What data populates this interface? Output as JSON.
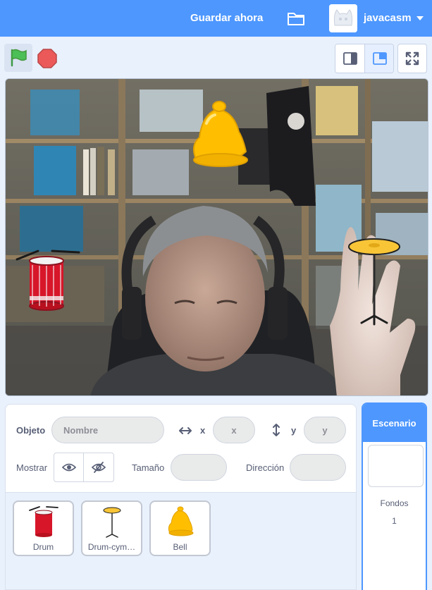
{
  "menu": {
    "save_now": "Guardar ahora",
    "username": "javacasm",
    "folder_icon": "folder-icon",
    "caret_icon": "caret-down-icon"
  },
  "controls": {
    "green_flag_icon": "green-flag-icon",
    "stop_icon": "stop-icon",
    "small_stage_icon": "small-stage-icon",
    "normal_stage_icon": "normal-stage-icon",
    "fullscreen_icon": "fullscreen-icon"
  },
  "stage": {
    "sprites": [
      "Drum",
      "Drum-cymbal",
      "Bell"
    ]
  },
  "sprite_info": {
    "sprite_label": "Objeto",
    "name_placeholder": "Nombre",
    "x_label": "x",
    "x_placeholder": "x",
    "y_label": "y",
    "y_placeholder": "y",
    "show_label": "Mostrar",
    "size_label": "Tamaño",
    "direction_label": "Dirección"
  },
  "sprite_list": [
    {
      "name": "Drum"
    },
    {
      "name": "Drum-cym…"
    },
    {
      "name": "Bell"
    }
  ],
  "stage_panel": {
    "title": "Escenario",
    "backdrops_label": "Fondos",
    "backdrops_count": "1"
  },
  "colors": {
    "menu_blue": "#4d97ff",
    "flag_green": "#4cbf56",
    "stop_red": "#ec5959",
    "drum_red": "#d7162a",
    "bell_yellow": "#ffbf00",
    "cymbal_yellow": "#f8c537"
  }
}
